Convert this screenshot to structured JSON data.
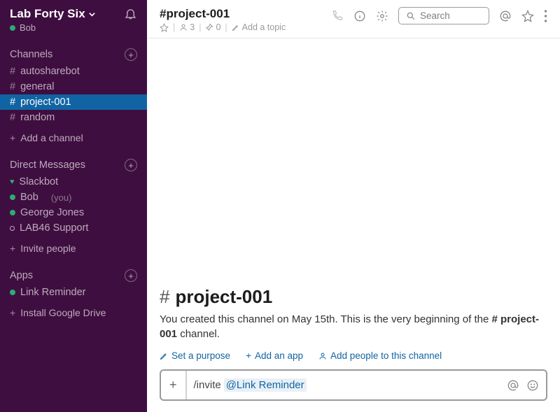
{
  "workspace": {
    "name": "Lab Forty Six",
    "user": "Bob"
  },
  "sidebar": {
    "channels_label": "Channels",
    "channels": [
      {
        "name": "autosharebot",
        "active": false
      },
      {
        "name": "general",
        "active": false
      },
      {
        "name": "project-001",
        "active": true
      },
      {
        "name": "random",
        "active": false
      }
    ],
    "add_channel": "Add a channel",
    "dm_label": "Direct Messages",
    "dms": [
      {
        "name": "Slackbot",
        "presence": "heart"
      },
      {
        "name": "Bob",
        "presence": "active",
        "you_label": "(you)"
      },
      {
        "name": "George Jones",
        "presence": "active"
      },
      {
        "name": "LAB46 Support",
        "presence": "away"
      }
    ],
    "invite_people": "Invite people",
    "apps_label": "Apps",
    "apps": [
      {
        "name": "Link Reminder",
        "presence": "active"
      }
    ],
    "install_gdrive": "Install Google Drive"
  },
  "header": {
    "channel_name": "#project-001",
    "member_count": "3",
    "pin_count": "0",
    "add_topic": "Add a topic",
    "search_placeholder": "Search"
  },
  "welcome": {
    "hash": "#",
    "title": "project-001",
    "text_pre": "You created this channel on May 15th. This is the very beginning of the ",
    "text_bold": "# project-001",
    "text_post": " channel.",
    "set_purpose": "Set a purpose",
    "add_app": "Add an app",
    "add_people": "Add people to this channel"
  },
  "composer": {
    "command": "/invite ",
    "mention": "@Link Reminder"
  }
}
